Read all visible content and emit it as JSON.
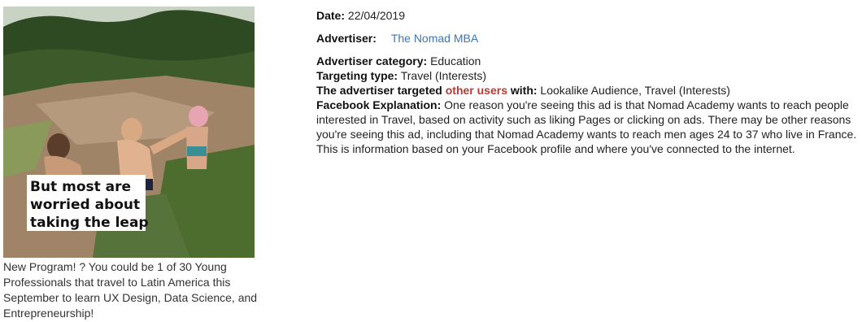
{
  "ad": {
    "overlay_text": [
      "But most are",
      "worried about",
      "taking the leap"
    ],
    "caption": "New Program! ? You could be 1 of 30 Young Professionals that travel to Latin America this September to learn UX Design, Data Science, and Entrepreneurship!"
  },
  "details": {
    "date_label": "Date:",
    "date_value": "22/04/2019",
    "advertiser_label": "Advertiser:",
    "advertiser_value": "The Nomad MBA",
    "category_label": "Advertiser category:",
    "category_value": "Education",
    "targeting_label": "Targeting type:",
    "targeting_value": "Travel (Interests)",
    "targeted_prefix": "The advertiser targeted",
    "targeted_link": "other users",
    "targeted_suffix": "with:",
    "targeted_value": "Lookalike Audience, Travel (Interests)",
    "explanation_label": "Facebook Explanation:",
    "explanation_value": "One reason you're seeing this ad is that Nomad Academy wants to reach people interested in Travel, based on activity such as liking Pages or clicking on ads. There may be other reasons you're seeing this ad, including that Nomad Academy wants to reach men ages 24 to 37 who live in France. This is information based on your Facebook profile and where you've connected to the internet."
  },
  "colors": {
    "link_blue": "#3a75b8",
    "highlight_red": "#b83a34"
  }
}
